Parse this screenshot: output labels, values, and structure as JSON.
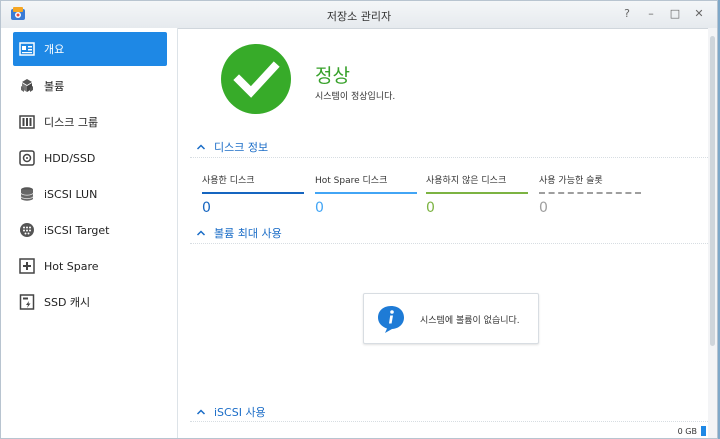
{
  "window": {
    "title": "저장소 관리자",
    "buttons": [
      "?",
      "–",
      "□",
      "✕"
    ]
  },
  "sidebar": {
    "items": [
      {
        "label": "개요",
        "icon": "overview-icon",
        "active": true
      },
      {
        "label": "볼륨",
        "icon": "volume-icon",
        "active": false
      },
      {
        "label": "디스크 그룹",
        "icon": "disk-group-icon",
        "active": false
      },
      {
        "label": "HDD/SSD",
        "icon": "hdd-icon",
        "active": false
      },
      {
        "label": "iSCSI LUN",
        "icon": "iscsi-lun-icon",
        "active": false
      },
      {
        "label": "iSCSI Target",
        "icon": "iscsi-target-icon",
        "active": false
      },
      {
        "label": "Hot Spare",
        "icon": "hot-spare-icon",
        "active": false
      },
      {
        "label": "SSD 캐시",
        "icon": "ssd-cache-icon",
        "active": false
      }
    ]
  },
  "status": {
    "title": "정상",
    "description": "시스템이 정상입니다.",
    "color": "#37ab29"
  },
  "disk_info": {
    "heading": "디스크 정보",
    "columns": [
      {
        "label": "사용한 디스크",
        "value": "0",
        "color": "#1565c0"
      },
      {
        "label": "Hot Spare 디스크",
        "value": "0",
        "color": "#42a5f5"
      },
      {
        "label": "사용하지 않은 디스크",
        "value": "0",
        "color": "#7cb342"
      },
      {
        "label": "사용 가능한 슬롯",
        "value": "0",
        "color": "#9e9e9e"
      }
    ]
  },
  "volume_usage": {
    "heading": "볼륨 최대 사용",
    "empty_message": "시스템에 볼륨이 없습니다."
  },
  "iscsi_usage": {
    "heading": "iSCSI 사용",
    "capacity": "0 GB"
  },
  "colors": {
    "accent": "#1e88e5",
    "section_heading": "#1a6cc7"
  }
}
